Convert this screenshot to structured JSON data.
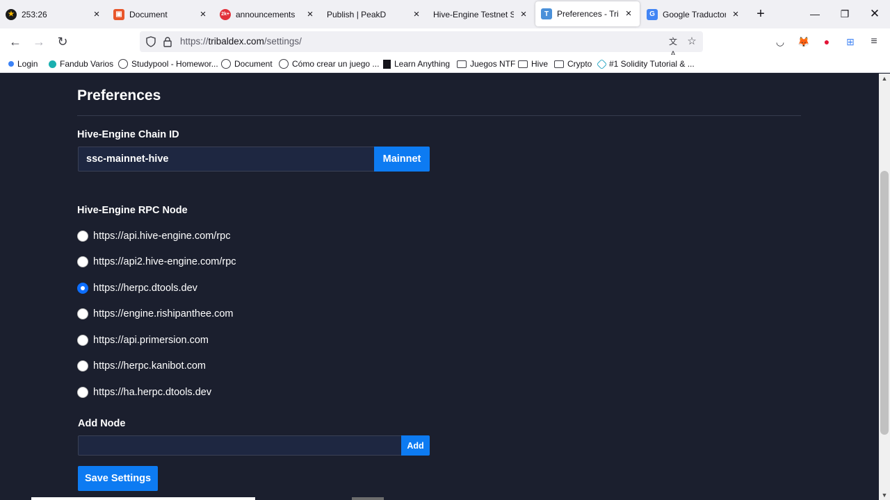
{
  "tabs": [
    {
      "title": "253:26",
      "icon": "star-circle-icon",
      "color": "#1a1a1a",
      "active": false
    },
    {
      "title": "Document",
      "icon": "document-favicon-icon",
      "color": "#e8562a",
      "active": false
    },
    {
      "title": "announcements",
      "icon": "discord-notification-icon",
      "color": "#e2313a",
      "badge": "2k+",
      "active": false
    },
    {
      "title": "Publish | PeakD",
      "icon": "",
      "color": "",
      "active": false
    },
    {
      "title": "Hive-Engine Testnet Setu",
      "icon": "",
      "color": "",
      "active": false
    },
    {
      "title": "Preferences - Tribaldex",
      "icon": "tribaldex-icon",
      "color": "#4a90d9",
      "badge": "T",
      "active": true
    },
    {
      "title": "Google Traductor",
      "icon": "google-translate-icon",
      "color": "#4285f4",
      "active": false
    }
  ],
  "url": {
    "scheme": "https://",
    "host": "tribaldex.com",
    "path": "/settings/"
  },
  "bookmarks": [
    {
      "label": "Login",
      "icon": "blue-dot-icon"
    },
    {
      "label": "Fandub Varios",
      "icon": "teal-bird-icon"
    },
    {
      "label": "Studypool - Homewor...",
      "icon": "globe-icon"
    },
    {
      "label": "Document",
      "icon": "globe-icon"
    },
    {
      "label": "Cómo crear un juego ...",
      "icon": "globe-icon"
    },
    {
      "label": "Learn Anything",
      "icon": "book-icon"
    },
    {
      "label": "Juegos NTF",
      "icon": "folder-icon"
    },
    {
      "label": "Hive",
      "icon": "folder-icon"
    },
    {
      "label": "Crypto",
      "icon": "folder-icon"
    },
    {
      "label": "#1 Solidity Tutorial & ...",
      "icon": "chain-link-icon"
    }
  ],
  "page": {
    "title": "Preferences",
    "chain_id_label": "Hive-Engine Chain ID",
    "chain_id_value": "ssc-mainnet-hive",
    "mainnet_label": "Mainnet",
    "rpc_label": "Hive-Engine RPC Node",
    "rpc_nodes": [
      {
        "url": "https://api.hive-engine.com/rpc",
        "selected": false
      },
      {
        "url": "https://api2.hive-engine.com/rpc",
        "selected": false
      },
      {
        "url": "https://herpc.dtools.dev",
        "selected": true
      },
      {
        "url": "https://engine.rishipanthee.com",
        "selected": false
      },
      {
        "url": "https://api.primersion.com",
        "selected": false
      },
      {
        "url": "https://herpc.kanibot.com",
        "selected": false
      },
      {
        "url": "https://ha.herpc.dtools.dev",
        "selected": false
      }
    ],
    "add_node_label": "Add Node",
    "add_node_value": "",
    "add_label": "Add",
    "save_label": "Save Settings"
  },
  "colors": {
    "accent": "#0d7bf2",
    "page_bg": "#1b1f2e",
    "input_bg": "#1e2741"
  }
}
